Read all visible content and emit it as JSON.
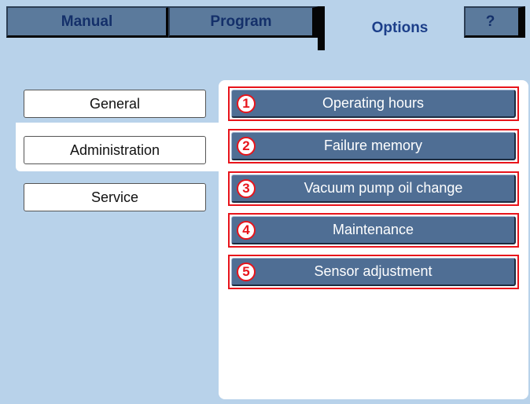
{
  "tabs": {
    "manual": "Manual",
    "program": "Program",
    "options": "Options",
    "help": "?"
  },
  "active_tab": "Options",
  "categories": {
    "general": "General",
    "administration": "Administration",
    "service": "Service"
  },
  "selected_category": "Service",
  "service_items": [
    {
      "number": "1",
      "label": "Operating hours"
    },
    {
      "number": "2",
      "label": "Failure memory"
    },
    {
      "number": "3",
      "label": "Vacuum pump oil change"
    },
    {
      "number": "4",
      "label": "Maintenance"
    },
    {
      "number": "5",
      "label": "Sensor adjustment"
    }
  ],
  "colors": {
    "background": "#b8d2ea",
    "tab_inactive": "#5b7a9c",
    "tab_text": "#1c3f8a",
    "button_blue": "#4f6e94",
    "highlight_red": "#e8141b"
  }
}
